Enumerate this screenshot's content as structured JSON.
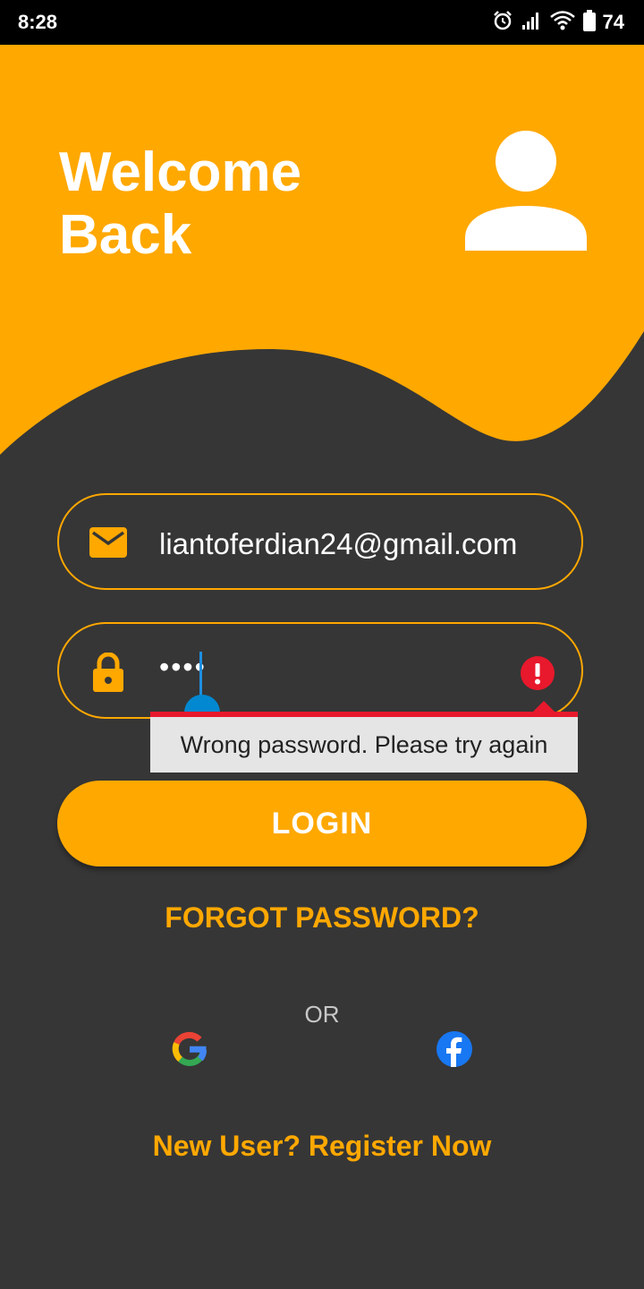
{
  "status_bar": {
    "time": "8:28",
    "battery": "74"
  },
  "hero": {
    "title_line1": "Welcome",
    "title_line2": "Back"
  },
  "email": {
    "value": "liantoferdian24@gmail.com"
  },
  "password": {
    "masked_value": "••••",
    "error": "Wrong password. Please try again"
  },
  "login": {
    "label": "LOGIN"
  },
  "forgot": {
    "label": "FORGOT PASSWORD?"
  },
  "divider": {
    "label": "OR"
  },
  "register": {
    "label": "New User? Register Now"
  },
  "colors": {
    "accent": "#FFA800",
    "background": "#363636",
    "error": "#E8192C"
  },
  "icons": [
    "alarm-icon",
    "signal-icon",
    "wifi-icon",
    "battery-icon",
    "avatar-icon",
    "mail-icon",
    "lock-icon",
    "error-icon",
    "google-icon",
    "facebook-icon"
  ]
}
